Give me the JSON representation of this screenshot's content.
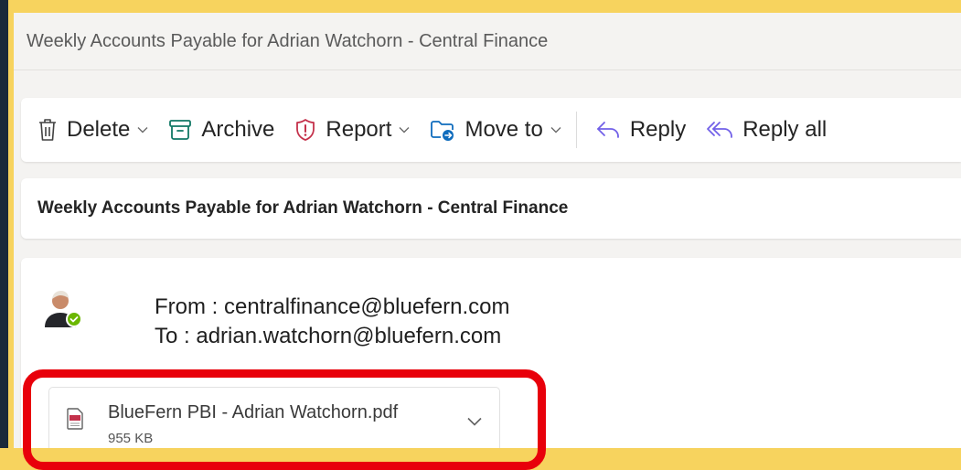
{
  "window": {
    "title": "Weekly Accounts Payable for Adrian Watchorn - Central Finance"
  },
  "toolbar": {
    "delete_label": "Delete",
    "archive_label": "Archive",
    "report_label": "Report",
    "move_label": "Move to",
    "reply_label": "Reply",
    "reply_all_label": "Reply all"
  },
  "message": {
    "subject": "Weekly Accounts Payable for Adrian Watchorn - Central Finance",
    "from_line": "From : centralfinance@bluefern.com",
    "to_line": "To : adrian.watchorn@bluefern.com",
    "attachment": {
      "name": "BlueFern PBI - Adrian Watchorn.pdf",
      "size": "955 KB"
    }
  },
  "colors": {
    "background": "#f7d35e",
    "highlight": "#e8000b",
    "accent": "#0f6cbd",
    "archive_green": "#117865",
    "report_red": "#c4314b",
    "presence_green": "#6bb700"
  },
  "icons": [
    "trash-icon",
    "archive-icon",
    "shield-alert-icon",
    "folder-move-icon",
    "reply-icon",
    "reply-all-icon",
    "pdf-icon",
    "chevron-down-icon"
  ]
}
